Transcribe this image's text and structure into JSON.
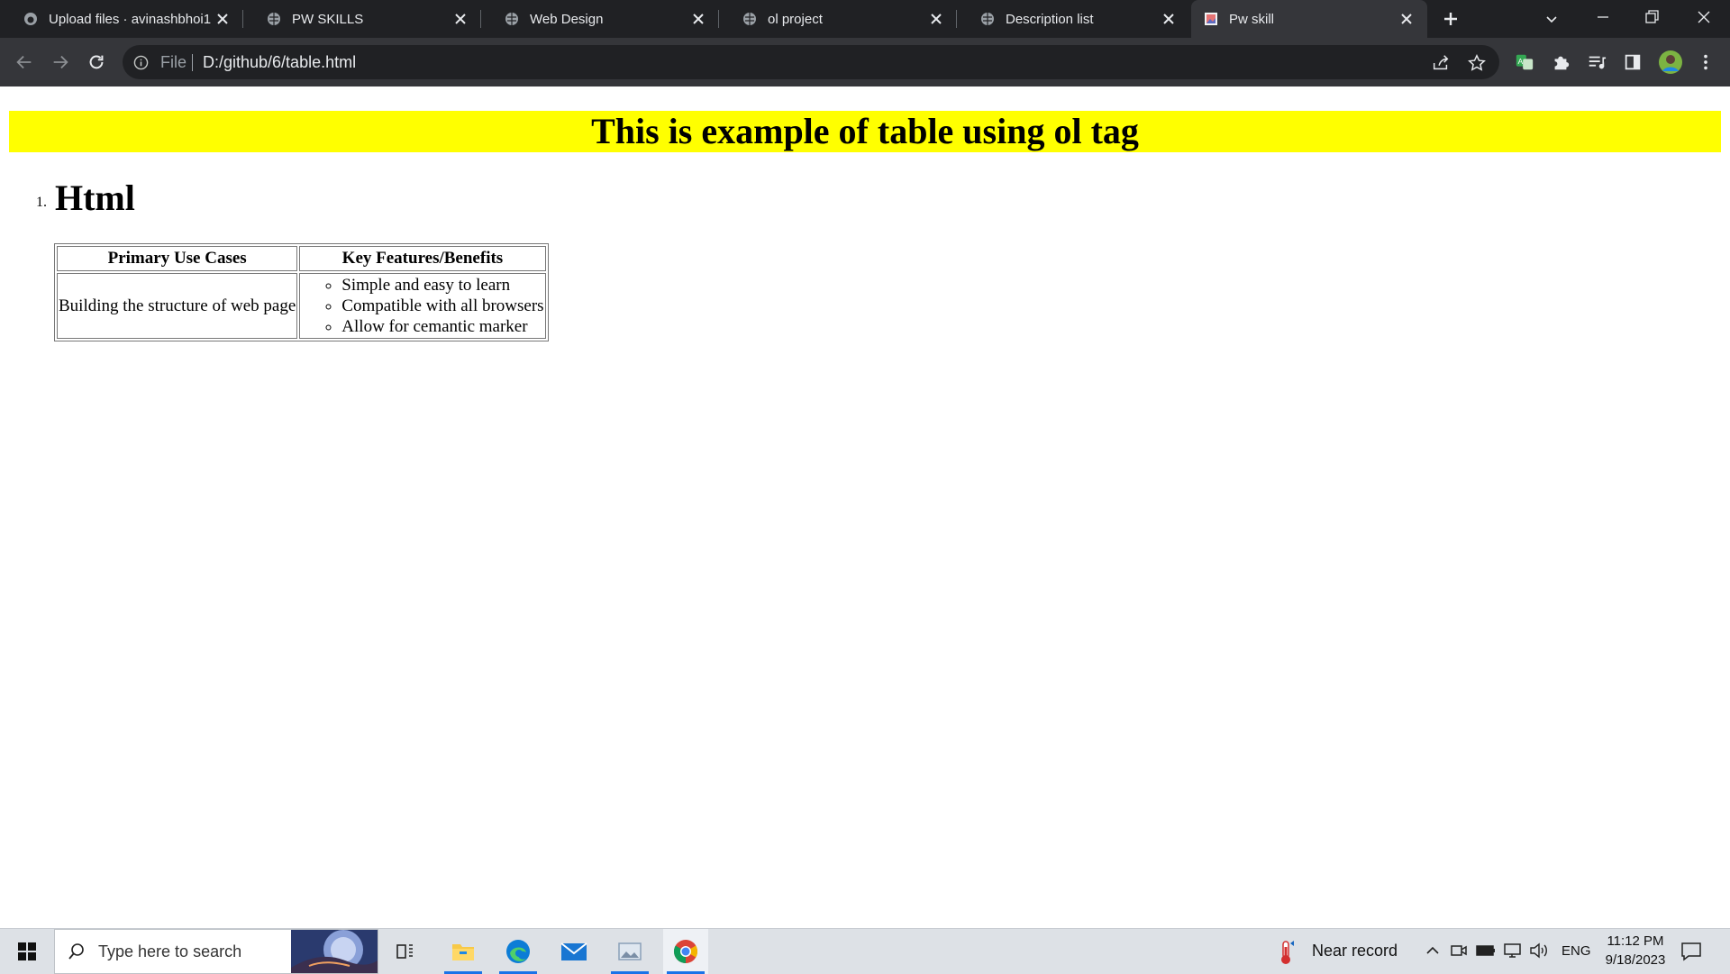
{
  "browser": {
    "tabs": [
      {
        "title": "Upload files · avinashbhoi1",
        "icon": "github-icon",
        "active": false
      },
      {
        "title": "PW SKILLS",
        "icon": "globe-icon",
        "active": false
      },
      {
        "title": "Web Design",
        "icon": "globe-icon",
        "active": false
      },
      {
        "title": "ol project",
        "icon": "globe-icon",
        "active": false
      },
      {
        "title": "Description list",
        "icon": "globe-icon",
        "active": false
      },
      {
        "title": "Pw skill",
        "icon": "image-icon",
        "active": true
      }
    ],
    "address": {
      "scheme_label": "File",
      "url": "D:/github/6/table.html"
    }
  },
  "page": {
    "heading": "This is example of table using ol tag",
    "list_number": "1.",
    "list_title": "Html",
    "table": {
      "headers": [
        "Primary Use Cases",
        "Key Features/Benefits"
      ],
      "use_case": "Building the structure of web page",
      "features": [
        "Simple and easy to learn",
        "Compatible with all browsers",
        "Allow for cemantic marker"
      ]
    }
  },
  "taskbar": {
    "search_placeholder": "Type here to search",
    "weather": "Near record",
    "language": "ENG",
    "time": "11:12 PM",
    "date": "9/18/2023"
  },
  "colors": {
    "banner": "#ffff00",
    "tabstrip": "#202124",
    "toolbar": "#35363a",
    "taskbar": "#dde1e6"
  }
}
